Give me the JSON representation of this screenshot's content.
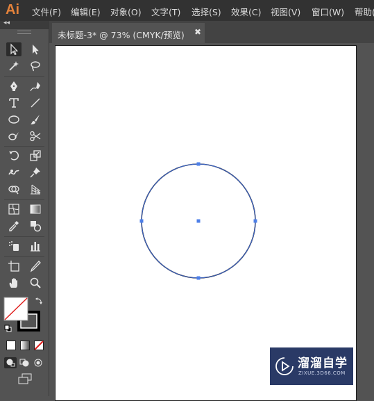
{
  "app": {
    "logo": "Ai"
  },
  "menu": [
    {
      "label": "文件(F)"
    },
    {
      "label": "编辑(E)"
    },
    {
      "label": "对象(O)"
    },
    {
      "label": "文字(T)"
    },
    {
      "label": "选择(S)"
    },
    {
      "label": "效果(C)"
    },
    {
      "label": "视图(V)"
    },
    {
      "label": "窗口(W)"
    },
    {
      "label": "帮助("
    }
  ],
  "toolbar": {
    "collapse_glyph": "◂◂"
  },
  "tools": [
    {
      "name": "selection-tool-icon",
      "icon": "selection-arrow",
      "selected": true
    },
    {
      "name": "direct-selection-tool-icon",
      "icon": "direct-selection-arrow"
    },
    {
      "name": "magic-wand-tool-icon",
      "icon": "magic-wand"
    },
    {
      "name": "lasso-tool-icon",
      "icon": "lasso"
    },
    {
      "name": "pen-tool-icon",
      "icon": "pen"
    },
    {
      "name": "curvature-tool-icon",
      "icon": "curvature-pen"
    },
    {
      "name": "type-tool-icon",
      "icon": "type"
    },
    {
      "name": "line-segment-tool-icon",
      "icon": "line"
    },
    {
      "name": "ellipse-tool-icon",
      "icon": "ellipse"
    },
    {
      "name": "paintbrush-tool-icon",
      "icon": "paintbrush"
    },
    {
      "name": "shaper-tool-icon",
      "icon": "shaper"
    },
    {
      "name": "scissors-tool-icon",
      "icon": "scissors"
    },
    {
      "name": "rotate-tool-icon",
      "icon": "rotate"
    },
    {
      "name": "scale-tool-icon",
      "icon": "scale"
    },
    {
      "name": "warp-tool-icon",
      "icon": "warp"
    },
    {
      "name": "puppet-warp-tool-icon",
      "icon": "pushpin"
    },
    {
      "name": "shape-builder-tool-icon",
      "icon": "shape-builder"
    },
    {
      "name": "perspective-grid-tool-icon",
      "icon": "perspective-grid"
    },
    {
      "name": "mesh-tool-icon",
      "icon": "mesh"
    },
    {
      "name": "gradient-tool-icon",
      "icon": "gradient"
    },
    {
      "name": "eyedropper-tool-icon",
      "icon": "eyedropper"
    },
    {
      "name": "blend-tool-icon",
      "icon": "blend"
    },
    {
      "name": "symbol-sprayer-tool-icon",
      "icon": "symbol-sprayer"
    },
    {
      "name": "column-graph-tool-icon",
      "icon": "column-graph"
    },
    {
      "name": "artboard-tool-icon",
      "icon": "artboard"
    },
    {
      "name": "slice-tool-icon",
      "icon": "slice"
    },
    {
      "name": "hand-tool-icon",
      "icon": "hand"
    },
    {
      "name": "zoom-tool-icon",
      "icon": "zoom"
    }
  ],
  "colors": {
    "fill": "#ffffff",
    "stroke": "#000000",
    "none_indicator": "#e0201e",
    "path": "#3c6bd6",
    "anchor": "#4d7fe8",
    "watermark_bg": "#2a3a66"
  },
  "document_tab": {
    "title": "未标题-3* @ 73% (CMYK/预览)",
    "close_glyph": "✖"
  },
  "artwork": {
    "shape": "circle",
    "state": "selected"
  },
  "watermark": {
    "text": "溜溜自学",
    "url": "ZIXUE.3D66.COM"
  }
}
